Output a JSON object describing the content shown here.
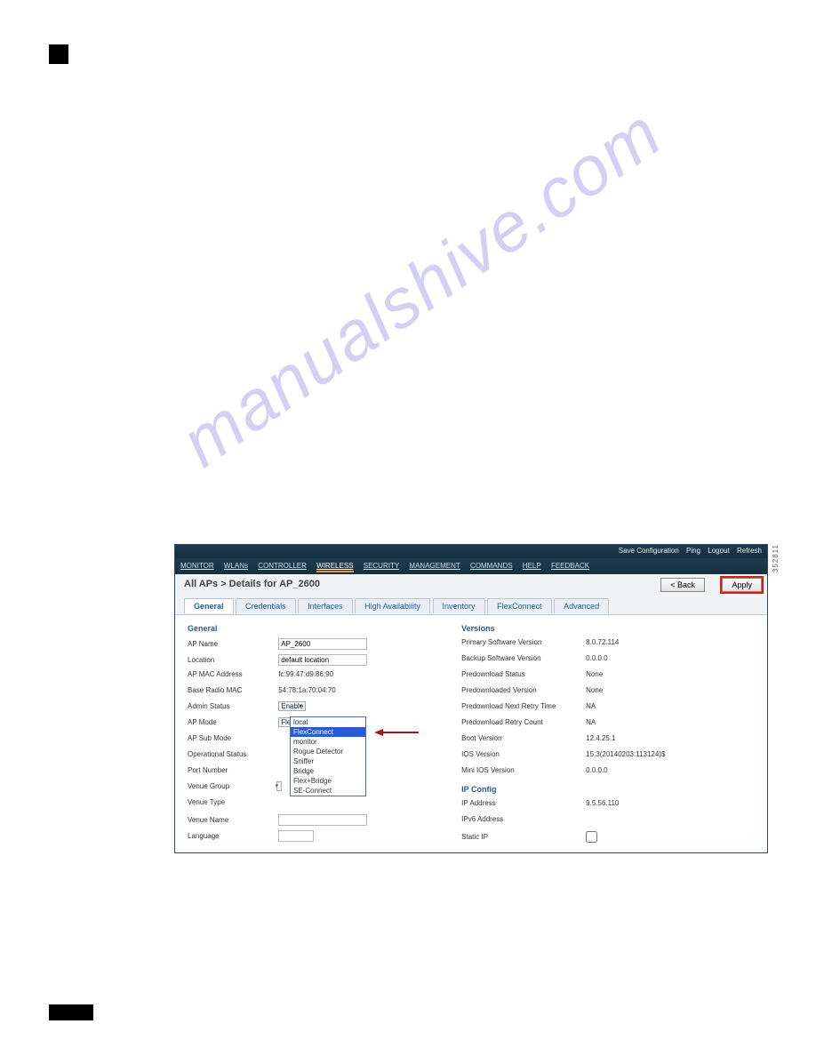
{
  "watermark": "manualshive.com",
  "side_id": "352811",
  "topbar": {
    "save": "Save Configuration",
    "ping": "Ping",
    "logout": "Logout",
    "refresh": "Refresh"
  },
  "nav": {
    "items": [
      "MONITOR",
      "WLANs",
      "CONTROLLER",
      "WIRELESS",
      "SECURITY",
      "MANAGEMENT",
      "COMMANDS",
      "HELP",
      "FEEDBACK"
    ],
    "active_index": 3
  },
  "titlerow": {
    "breadcrumb": "All APs > Details for AP_2600",
    "back": "< Back",
    "apply": "Apply"
  },
  "tabs": {
    "items": [
      "General",
      "Credentials",
      "Interfaces",
      "High Availability",
      "Inventory",
      "FlexConnect",
      "Advanced"
    ],
    "active_index": 0
  },
  "general": {
    "header": "General",
    "rows": {
      "ap_name": {
        "label": "AP Name",
        "value": "AP_2600"
      },
      "location": {
        "label": "Location",
        "value": "default location"
      },
      "ap_mac": {
        "label": "AP MAC Address",
        "value": "fc:99:47:d9:86:90"
      },
      "base_mac": {
        "label": "Base Radio MAC",
        "value": "54:78:1a:70:04:70"
      },
      "admin_status": {
        "label": "Admin Status",
        "value": "Enable"
      },
      "ap_mode": {
        "label": "AP Mode",
        "value": "FlexConnect"
      },
      "ap_sub_mode": {
        "label": "AP Sub Mode"
      },
      "oper_status": {
        "label": "Operational Status"
      },
      "port": {
        "label": "Port Number"
      },
      "venue_group": {
        "label": "Venue Group"
      },
      "venue_type": {
        "label": "Venue Type"
      },
      "venue_name": {
        "label": "Venue Name"
      },
      "language": {
        "label": "Language"
      }
    },
    "dropdown_options": [
      "local",
      "FlexConnect",
      "monitor",
      "Rogue Detector",
      "Sniffer",
      "Bridge",
      "Flex+Bridge",
      "SE-Connect"
    ],
    "dropdown_selected_index": 1
  },
  "versions": {
    "header": "Versions",
    "rows": {
      "primary_sw": {
        "label": "Primary Software Version",
        "value": "8.0.72.114"
      },
      "backup_sw": {
        "label": "Backup Software Version",
        "value": "0.0.0.0"
      },
      "pred_status": {
        "label": "Predownload Status",
        "value": "None"
      },
      "pred_ver": {
        "label": "Predownloaded Version",
        "value": "None"
      },
      "pred_retry_time": {
        "label": "Predownload Next Retry Time",
        "value": "NA"
      },
      "pred_retry_count": {
        "label": "Predownload Retry Count",
        "value": "NA"
      },
      "boot_ver": {
        "label": "Boot Version",
        "value": "12.4.25.1"
      },
      "ios_ver": {
        "label": "IOS Version",
        "value": "15.3(20140203:113124)$"
      },
      "mini_ios": {
        "label": "Mini IOS Version",
        "value": "0.0.0.0"
      }
    }
  },
  "ipconfig": {
    "header": "IP Config",
    "rows": {
      "ip": {
        "label": "IP Address",
        "value": "9.5.56.110"
      },
      "ipv6": {
        "label": "IPv6 Address",
        "value": ""
      },
      "static": {
        "label": "Static IP"
      }
    }
  }
}
